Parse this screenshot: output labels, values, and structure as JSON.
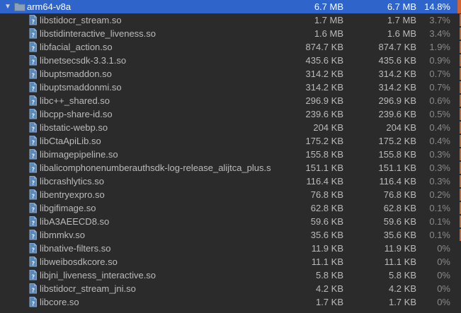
{
  "root": {
    "name": "arm64-v8a",
    "raw_size": "6.7 MB",
    "download_size": "6.7 MB",
    "percent": "14.8%",
    "bar_fraction": 0.148
  },
  "files": [
    {
      "name": "libstidocr_stream.so",
      "raw": "1.7 MB",
      "dl": "1.7 MB",
      "pct": "3.7%",
      "bar_fraction": 0.037
    },
    {
      "name": "libstidinteractive_liveness.so",
      "raw": "1.6 MB",
      "dl": "1.6 MB",
      "pct": "3.4%",
      "bar_fraction": 0.034
    },
    {
      "name": "libfacial_action.so",
      "raw": "874.7 KB",
      "dl": "874.7 KB",
      "pct": "1.9%",
      "bar_fraction": 0.019
    },
    {
      "name": "libnetsecsdk-3.3.1.so",
      "raw": "435.6 KB",
      "dl": "435.6 KB",
      "pct": "0.9%",
      "bar_fraction": 0.009
    },
    {
      "name": "libuptsmaddon.so",
      "raw": "314.2 KB",
      "dl": "314.2 KB",
      "pct": "0.7%",
      "bar_fraction": 0.007
    },
    {
      "name": "libuptsmaddonmi.so",
      "raw": "314.2 KB",
      "dl": "314.2 KB",
      "pct": "0.7%",
      "bar_fraction": 0.007
    },
    {
      "name": "libc++_shared.so",
      "raw": "296.9 KB",
      "dl": "296.9 KB",
      "pct": "0.6%",
      "bar_fraction": 0.006
    },
    {
      "name": "libcpp-share-id.so",
      "raw": "239.6 KB",
      "dl": "239.6 KB",
      "pct": "0.5%",
      "bar_fraction": 0.005
    },
    {
      "name": "libstatic-webp.so",
      "raw": "204 KB",
      "dl": "204 KB",
      "pct": "0.4%",
      "bar_fraction": 0.004
    },
    {
      "name": "libCtaApiLib.so",
      "raw": "175.2 KB",
      "dl": "175.2 KB",
      "pct": "0.4%",
      "bar_fraction": 0.004
    },
    {
      "name": "libimagepipeline.so",
      "raw": "155.8 KB",
      "dl": "155.8 KB",
      "pct": "0.3%",
      "bar_fraction": 0.003
    },
    {
      "name": "libalicomphonenumberauthsdk-log-release_alijtca_plus.s",
      "raw": "151.1 KB",
      "dl": "151.1 KB",
      "pct": "0.3%",
      "bar_fraction": 0.003
    },
    {
      "name": "libcrashlytics.so",
      "raw": "116.4 KB",
      "dl": "116.4 KB",
      "pct": "0.3%",
      "bar_fraction": 0.003
    },
    {
      "name": "libentryexpro.so",
      "raw": "76.8 KB",
      "dl": "76.8 KB",
      "pct": "0.2%",
      "bar_fraction": 0.002
    },
    {
      "name": "libgifimage.so",
      "raw": "62.8 KB",
      "dl": "62.8 KB",
      "pct": "0.1%",
      "bar_fraction": 0.001
    },
    {
      "name": "libA3AEECD8.so",
      "raw": "59.6 KB",
      "dl": "59.6 KB",
      "pct": "0.1%",
      "bar_fraction": 0.001
    },
    {
      "name": "libmmkv.so",
      "raw": "35.6 KB",
      "dl": "35.6 KB",
      "pct": "0.1%",
      "bar_fraction": 0.001
    },
    {
      "name": "libnative-filters.so",
      "raw": "11.9 KB",
      "dl": "11.9 KB",
      "pct": "0%",
      "bar_fraction": 0
    },
    {
      "name": "libweibosdkcore.so",
      "raw": "11.1 KB",
      "dl": "11.1 KB",
      "pct": "0%",
      "bar_fraction": 0
    },
    {
      "name": "libjni_liveness_interactive.so",
      "raw": "5.8 KB",
      "dl": "5.8 KB",
      "pct": "0%",
      "bar_fraction": 0
    },
    {
      "name": "libstidocr_stream_jni.so",
      "raw": "4.2 KB",
      "dl": "4.2 KB",
      "pct": "0%",
      "bar_fraction": 0
    },
    {
      "name": "libcore.so",
      "raw": "1.7 KB",
      "dl": "1.7 KB",
      "pct": "0%",
      "bar_fraction": 0
    }
  ],
  "icons": {
    "expand": "chevron-down-icon",
    "folder": "folder-icon",
    "file": "unknown-file-icon"
  },
  "colors": {
    "background": "#2b2b2b",
    "selection": "#2f65ca",
    "bar": "#d6622c",
    "file_icon": "#6a9fd4"
  }
}
